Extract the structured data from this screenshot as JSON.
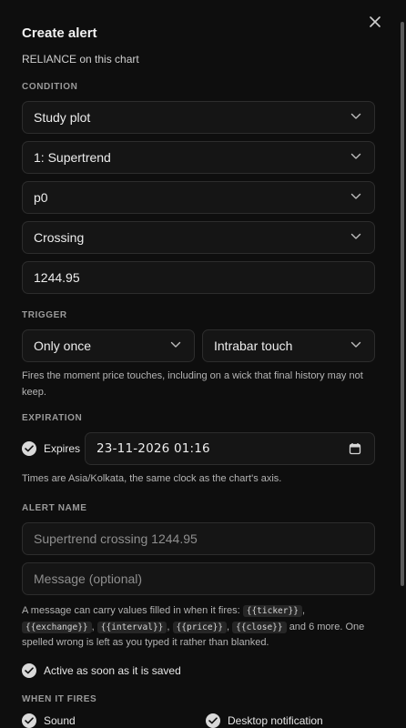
{
  "dialog": {
    "title": "Create alert",
    "subtitle": "RELIANCE on this chart"
  },
  "condition": {
    "label": "CONDITION",
    "source": "Study plot",
    "study": "1: Supertrend",
    "plot": "p0",
    "operator": "Crossing",
    "value": "1244.95"
  },
  "trigger": {
    "label": "TRIGGER",
    "frequency": "Only once",
    "mode": "Intrabar touch",
    "help": "Fires the moment price touches, including on a wick that final history may not keep."
  },
  "expiration": {
    "label": "EXPIRATION",
    "expires_label": "Expires",
    "expires_checked": true,
    "datetime": "23-11-2026 01:16",
    "help": "Times are Asia/Kolkata, the same clock as the chart's axis."
  },
  "alert_name": {
    "label": "ALERT NAME",
    "name_placeholder": "Supertrend crossing 1244.95",
    "message_placeholder": "Message (optional)",
    "help_prefix": "A message can carry values filled in when it fires:",
    "tokens": [
      "{{ticker}}",
      "{{exchange}}",
      "{{interval}}",
      "{{price}}",
      "{{close}}"
    ],
    "help_suffix": "and 6 more. One spelled wrong is left as you typed it rather than blanked."
  },
  "active": {
    "label": "Active as soon as it is saved",
    "checked": true
  },
  "when_fires": {
    "label": "WHEN IT FIRES",
    "sound": "Sound",
    "desktop": "Desktop notification"
  },
  "icons": {
    "close": "close-icon",
    "chevron": "chevron-down-icon",
    "calendar": "calendar-icon",
    "check": "check-icon"
  },
  "colors": {
    "background": "#0e0e0e",
    "field": "#151515",
    "border": "#2d2d2d",
    "text": "#ededed",
    "muted": "#9a9a9a"
  }
}
